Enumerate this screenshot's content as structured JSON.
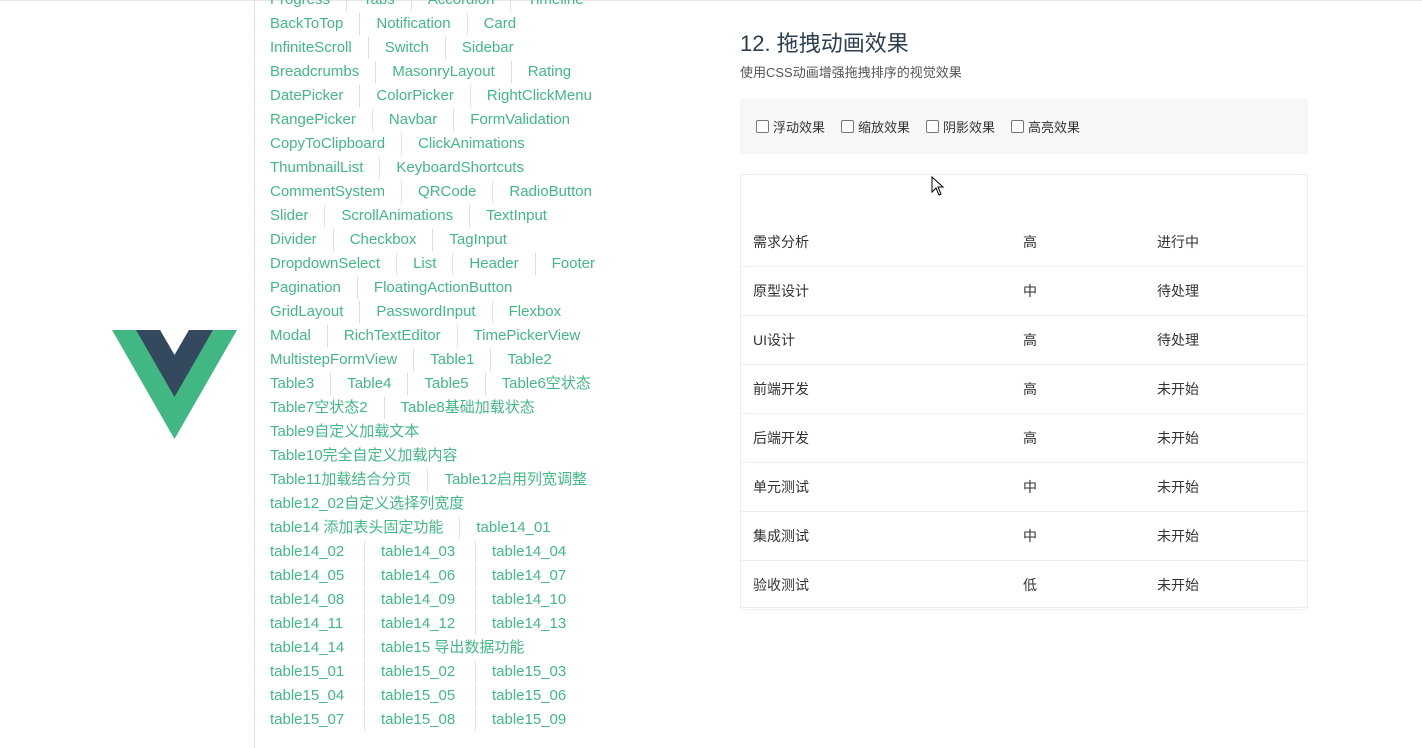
{
  "nav": {
    "rows": [
      [
        "Progress",
        "Tabs",
        "Accordion",
        "Timeline"
      ],
      [
        "BackToTop",
        "Notification",
        "Card"
      ],
      [
        "InfiniteScroll",
        "Switch",
        "Sidebar"
      ],
      [
        "Breadcrumbs",
        "MasonryLayout",
        "Rating"
      ],
      [
        "DatePicker",
        "ColorPicker",
        "RightClickMenu"
      ],
      [
        "RangePicker",
        "Navbar",
        "FormValidation"
      ],
      [
        "CopyToClipboard",
        "ClickAnimations"
      ],
      [
        "ThumbnailList",
        "KeyboardShortcuts"
      ],
      [
        "CommentSystem",
        "QRCode",
        "RadioButton"
      ],
      [
        "Slider",
        "ScrollAnimations",
        "TextInput"
      ],
      [
        "Divider",
        "Checkbox",
        "TagInput"
      ],
      [
        "DropdownSelect",
        "List",
        "Header",
        "Footer"
      ],
      [
        "Pagination",
        "FloatingActionButton"
      ],
      [
        "GridLayout",
        "PasswordInput",
        "Flexbox"
      ],
      [
        "Modal",
        "RichTextEditor",
        "TimePickerView"
      ],
      [
        "MultistepFormView",
        "Table1",
        "Table2"
      ],
      [
        "Table3",
        "Table4",
        "Table5",
        "Table6空状态"
      ],
      [
        "Table7空状态2",
        "Table8基础加载状态"
      ],
      [
        "Table9自定义加载文本"
      ],
      [
        "Table10完全自定义加载内容"
      ],
      [
        "Table11加载结合分页",
        "Table12启用列宽调整"
      ],
      [
        "table12_02自定义选择列宽度"
      ],
      [
        "table14 添加表头固定功能",
        "table14_01"
      ],
      [
        "table14_02",
        "table14_03",
        "table14_04"
      ],
      [
        "table14_05",
        "table14_06",
        "table14_07"
      ],
      [
        "table14_08",
        "table14_09",
        "table14_10"
      ],
      [
        "table14_11",
        "table14_12",
        "table14_13"
      ],
      [
        "table14_14",
        "table15 导出数据功能"
      ],
      [
        "table15_01",
        "table15_02",
        "table15_03"
      ],
      [
        "table15_04",
        "table15_05",
        "table15_06"
      ],
      [
        "table15_07",
        "table15_08",
        "table15_09"
      ]
    ]
  },
  "section": {
    "title": "12. 拖拽动画效果",
    "subtitle": "使用CSS动画增强拖拽排序的视觉效果"
  },
  "options": [
    "浮动效果",
    "缩放效果",
    "阴影效果",
    "高亮效果"
  ],
  "table": {
    "rows": [
      [
        "需求分析",
        "高",
        "进行中"
      ],
      [
        "原型设计",
        "中",
        "待处理"
      ],
      [
        "UI设计",
        "高",
        "待处理"
      ],
      [
        "前端开发",
        "高",
        "未开始"
      ],
      [
        "后端开发",
        "高",
        "未开始"
      ],
      [
        "单元测试",
        "中",
        "未开始"
      ],
      [
        "集成测试",
        "中",
        "未开始"
      ],
      [
        "验收测试",
        "低",
        "未开始"
      ]
    ]
  },
  "colors": {
    "accent": "#42b983",
    "logo_dark": "#35495e",
    "logo_green": "#41b883"
  }
}
